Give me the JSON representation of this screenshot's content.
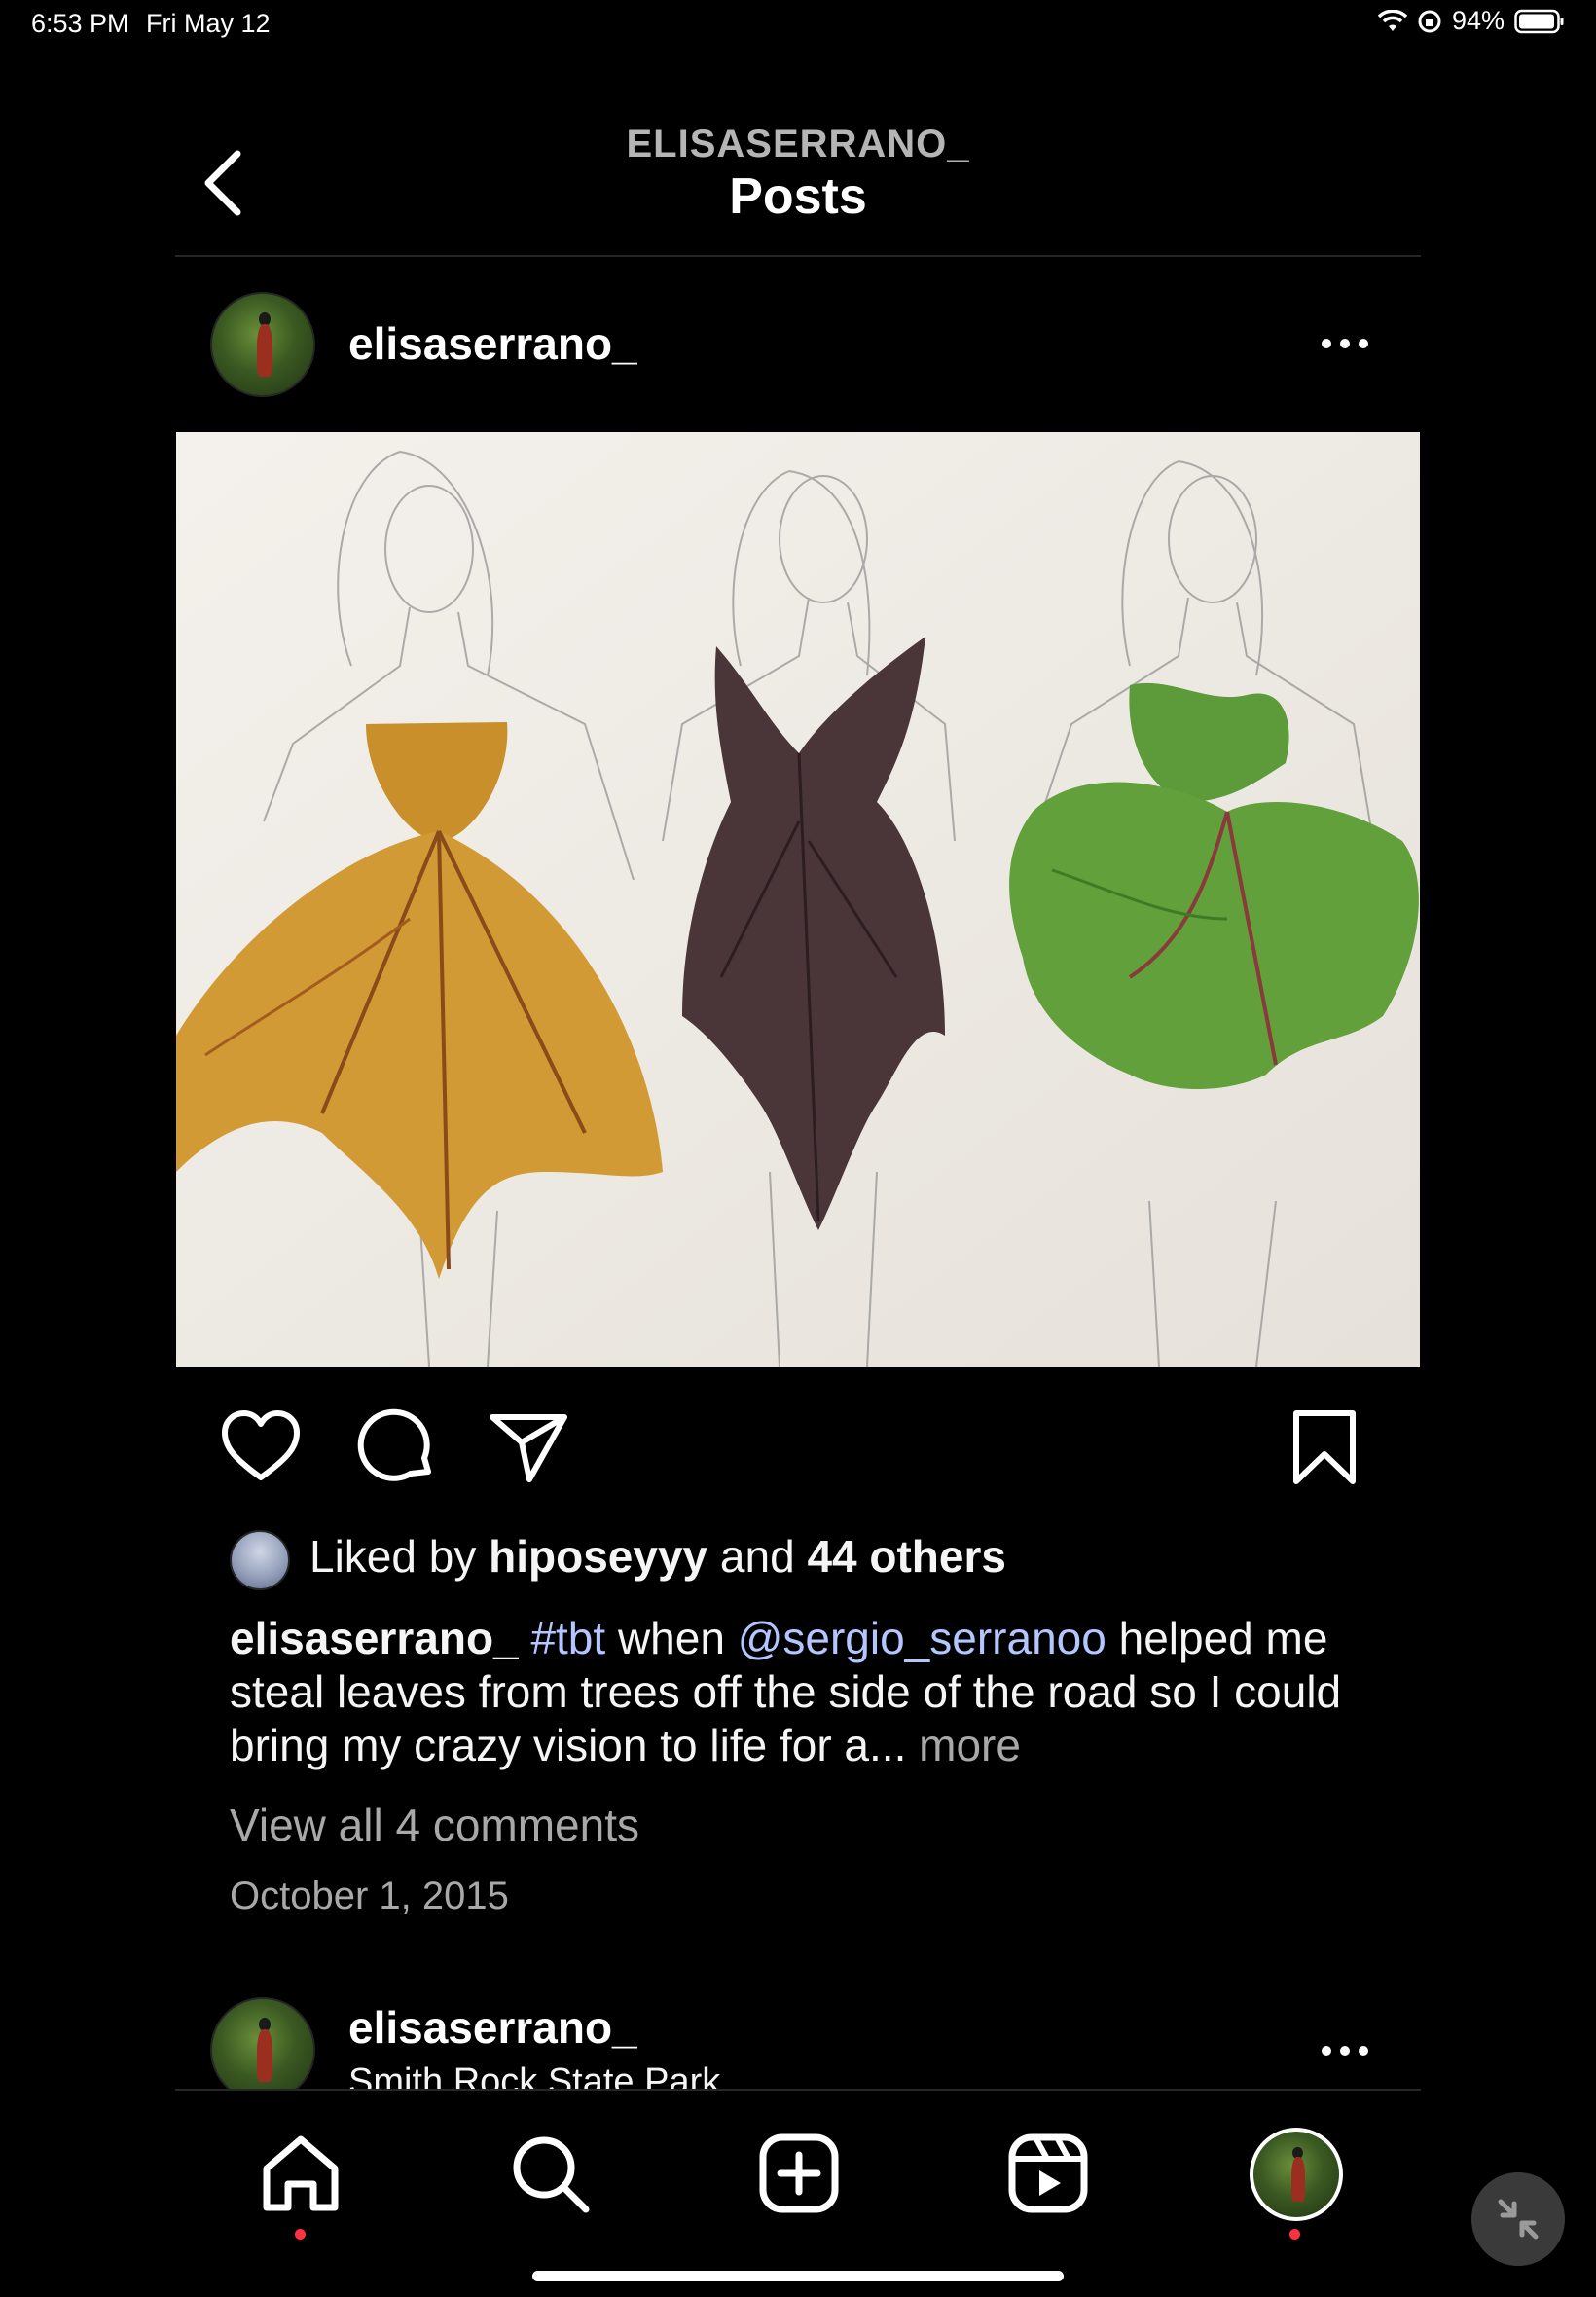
{
  "status_bar": {
    "time": "6:53 PM",
    "date": "Fri May 12",
    "battery": "94%"
  },
  "header": {
    "username": "ELISASERRANO_",
    "title": "Posts"
  },
  "post": {
    "username": "elisaserrano_",
    "liked_by_prefix": "Liked by ",
    "liked_by_user": "hiposeyyy",
    "liked_by_and": " and ",
    "liked_by_others": "44 others",
    "caption_user": "elisaserrano_",
    "caption_tag": "#tbt",
    "caption_part1": " when ",
    "caption_mention": "@sergio_serranoo",
    "caption_part2": " helped me steal leaves from trees off the side of the road so I could bring my crazy vision to life for a... ",
    "caption_more": "more",
    "view_comments": "View all 4 comments",
    "date": "October 1, 2015"
  },
  "next_post": {
    "username": "elisaserrano_",
    "location": "Smith Rock State Park"
  },
  "colors": {
    "background": "#000000",
    "link": "#b3c6ff",
    "secondary_text": "#a8a8a8",
    "notification_dot": "#ff3040"
  },
  "icons": [
    "back-icon",
    "more-icon",
    "heart-icon",
    "comment-icon",
    "share-icon",
    "bookmark-icon",
    "home-icon",
    "search-icon",
    "create-icon",
    "reels-icon",
    "profile-icon",
    "shrink-icon"
  ]
}
